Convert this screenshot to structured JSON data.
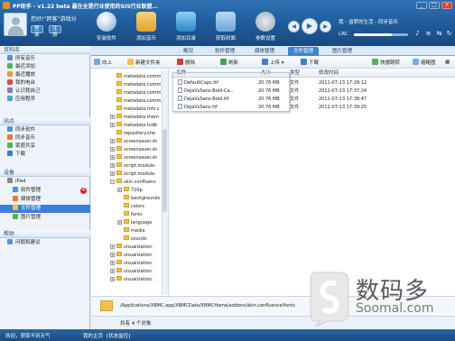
{
  "window": {
    "title": "PP助手 - v1.22 beta  最在全是行业使用的SIS行业联盟...",
    "min_label": "_",
    "max_label": "□",
    "close_label": "×"
  },
  "profile": {
    "greeting": "您好!“跨客”游戏分",
    "login_label": "登录",
    "register_label": "注册"
  },
  "toolbar": {
    "buttons": [
      {
        "label": "安装软件",
        "icon": "disc-icon"
      },
      {
        "label": "添加音乐",
        "icon": "music-icon"
      },
      {
        "label": "添加目录",
        "icon": "folder-add-icon"
      },
      {
        "label": "获取封面",
        "icon": "cover-icon"
      },
      {
        "label": "参数设置",
        "icon": "settings-icon"
      }
    ]
  },
  "player": {
    "prev": "◀",
    "play": "▶",
    "next": "▶",
    "now_playing": "我 - 追梦的生活 - 同步音乐",
    "lrc_label": "LRC",
    "volume": 0.7
  },
  "sidebar": {
    "sections": [
      {
        "title": "资料库",
        "items": [
          {
            "label": "所有音乐",
            "color": "#5a8fd6"
          },
          {
            "label": "最近添加",
            "color": "#58b05e"
          },
          {
            "label": "最近播放",
            "color": "#e0a030"
          },
          {
            "label": "我的电台",
            "color": "#d05050"
          },
          {
            "label": "认识我自己",
            "color": "#9a70c8"
          },
          {
            "label": "应用程序",
            "color": "#4aa7c9"
          }
        ]
      },
      {
        "title": "站点",
        "items": [
          {
            "label": "同步软件",
            "color": "#5a8fd6"
          },
          {
            "label": "同步音乐",
            "color": "#e07c2c"
          },
          {
            "label": "家庭共享",
            "color": "#58b05e"
          },
          {
            "label": "下载",
            "color": "#3d7fc9"
          }
        ]
      },
      {
        "title": "设备",
        "items": [
          {
            "label": "iPad",
            "color": "#888888"
          },
          {
            "label": "软件管理",
            "color": "#5a8fd6",
            "badge": "4"
          },
          {
            "label": "媒体管理",
            "color": "#e07c2c"
          },
          {
            "label": "文件管理",
            "color": "#f2c24b",
            "selected": true
          },
          {
            "label": "图片管理",
            "color": "#58b05e"
          }
        ]
      },
      {
        "title": "帮助",
        "items": [
          {
            "label": "问题和建议",
            "color": "#5a8fd6"
          }
        ]
      }
    ]
  },
  "tabs": [
    "概况",
    "软件管理",
    "媒体管理",
    "文件管理",
    "图片管理"
  ],
  "file_toolbar": {
    "up": "向上",
    "new_folder": "新建文件夹",
    "delete": "删除",
    "refresh": "刷新",
    "upload": "上传",
    "download": "下载",
    "quick_jump": "快捷跳转",
    "thumbnails": "缩略图"
  },
  "tree": {
    "rows": [
      "metadata.comm",
      "metadata.comm",
      "metadata.comm",
      "metadata.comm",
      "metadata.mtv.c",
      "metadata.them",
      "metadata.tvdb",
      "repository.she",
      "screensaver.sh",
      "screensaver.sh",
      "screensaver.sh",
      "script.module.",
      "script.module.",
      "skin.confluenc",
      "720p",
      "backgrounds",
      "colors",
      "fonts",
      "language",
      "media",
      "sounds",
      "visualization.",
      "visualization.",
      "visualization.",
      "visualization.",
      "visualization."
    ]
  },
  "file_list": {
    "columns": [
      "名称",
      "大小",
      "类型",
      "修改时间"
    ],
    "rows": [
      {
        "name": "DefaultCaps.ttf",
        "size": "20.76 MB",
        "type": "文件",
        "modified": "2011-07-13 17:28:12"
      },
      {
        "name": "DejaVuSans-Bold-Ca...",
        "size": "20.76 MB",
        "type": "文件",
        "modified": "2011-07-13 17:37:24"
      },
      {
        "name": "DejaVuSans-Bold.ttf",
        "size": "20.76 MB",
        "type": "文件",
        "modified": "2011-07-13 17:38:47"
      },
      {
        "name": "DejaVuSans.ttf",
        "size": "20.76 MB",
        "type": "文件",
        "modified": "2011-07-13 17:39:25"
      }
    ]
  },
  "path": {
    "value": "/Applications/XBMC.app/XBMCData/XBMCHome/addons/skin.confluence/fonts",
    "count_text": "共有 4 个对象"
  },
  "status": {
    "left": "欢迎，获取不到天气",
    "middle": "我的主页",
    "link": "[状态监控]"
  },
  "watermark": {
    "cn": "数码多",
    "url": "Soomal.com"
  }
}
